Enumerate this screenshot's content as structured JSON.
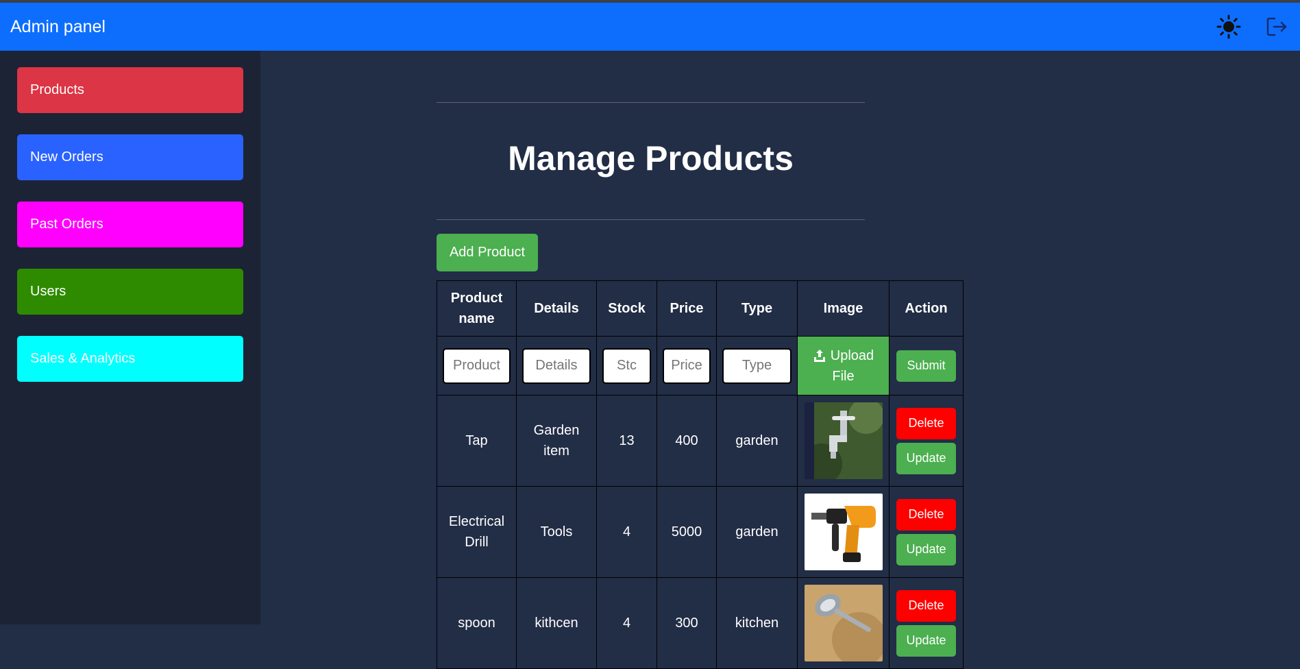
{
  "header": {
    "title": "Admin panel"
  },
  "sidebar": {
    "items": [
      {
        "label": "Products",
        "color": "#dc3545"
      },
      {
        "label": "New Orders",
        "color": "#2962ff"
      },
      {
        "label": "Past Orders",
        "color": "#ff00ff"
      },
      {
        "label": "Users",
        "color": "#2e8b00"
      },
      {
        "label": "Sales & Analytics",
        "color": "#00ffff"
      }
    ]
  },
  "main": {
    "title": "Manage Products",
    "add_button": "Add Product",
    "table": {
      "headers": [
        "Product name",
        "Details",
        "Stock",
        "Price",
        "Type",
        "Image",
        "Action"
      ],
      "input_placeholders": {
        "name": "Product",
        "details": "Details",
        "stock": "Stc",
        "price": "Price",
        "type": "Type"
      },
      "upload_label_1": "Upload",
      "upload_label_2": "File",
      "submit_label": "Submit",
      "delete_label": "Delete",
      "update_label": "Update",
      "rows": [
        {
          "name": "Tap",
          "details": "Garden item",
          "stock": "13",
          "price": "400",
          "type": "garden",
          "image": "tap-image"
        },
        {
          "name": "Electrical Drill",
          "details": "Tools",
          "stock": "4",
          "price": "5000",
          "type": "garden",
          "image": "drill-image"
        },
        {
          "name": "spoon",
          "details": "kithcen",
          "stock": "4",
          "price": "300",
          "type": "kitchen",
          "image": "spoon-image"
        }
      ]
    }
  },
  "icons": {
    "theme": "sun-icon",
    "logout": "logout-icon",
    "upload": "upload-icon"
  }
}
